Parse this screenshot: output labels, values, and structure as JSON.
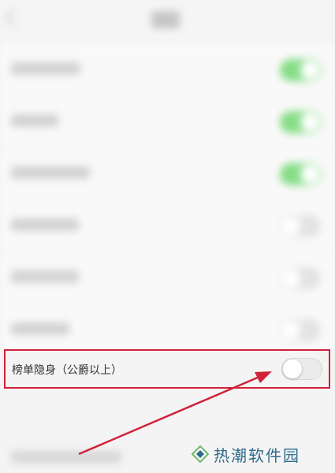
{
  "settings": {
    "highlighted_item": {
      "label": "榜单隐身（公爵以上）",
      "toggle_on": false
    },
    "blurred_rows": [
      {
        "toggle_on": true
      },
      {
        "toggle_on": true
      },
      {
        "toggle_on": true
      },
      {
        "toggle_on": false
      },
      {
        "toggle_on": false
      },
      {
        "toggle_on": false
      }
    ]
  },
  "watermark": {
    "text": "热潮软件园"
  },
  "colors": {
    "highlight": "#d1213a",
    "toggle_on": "#86dd86",
    "watermark": "#2e6c8c"
  }
}
